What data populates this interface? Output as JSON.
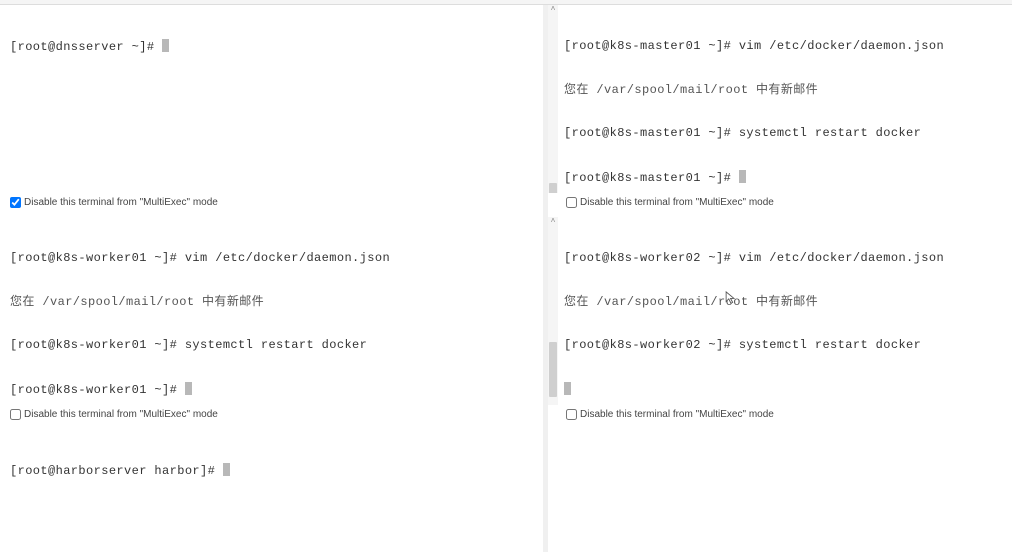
{
  "panes": {
    "dnsserver": {
      "prompt": "[root@dnsserver ~]# ",
      "disable_label": "Disable this terminal from \"MultiExec\" mode",
      "disable_checked": true
    },
    "k8s_master01": {
      "l1": "[root@k8s-master01 ~]# vim /etc/docker/daemon.json",
      "l2": "您在 /var/spool/mail/root 中有新邮件",
      "l3": "[root@k8s-master01 ~]# systemctl restart docker",
      "l4": "[root@k8s-master01 ~]# ",
      "disable_label": "Disable this terminal from \"MultiExec\" mode",
      "disable_checked": false
    },
    "k8s_worker01": {
      "l1": "[root@k8s-worker01 ~]# vim /etc/docker/daemon.json",
      "l2": "您在 /var/spool/mail/root 中有新邮件",
      "l3": "[root@k8s-worker01 ~]# systemctl restart docker",
      "l4": "[root@k8s-worker01 ~]# ",
      "disable_label": "Disable this terminal from \"MultiExec\" mode",
      "disable_checked": false
    },
    "k8s_worker02": {
      "l1": "[root@k8s-worker02 ~]# vim /etc/docker/daemon.json",
      "l2": "您在 /var/spool/mail/root 中有新邮件",
      "l3": "[root@k8s-worker02 ~]# systemctl restart docker",
      "disable_label": "Disable this terminal from \"MultiExec\" mode",
      "disable_checked": false
    },
    "harborserver": {
      "prompt": "[root@harborserver harbor]# "
    }
  }
}
